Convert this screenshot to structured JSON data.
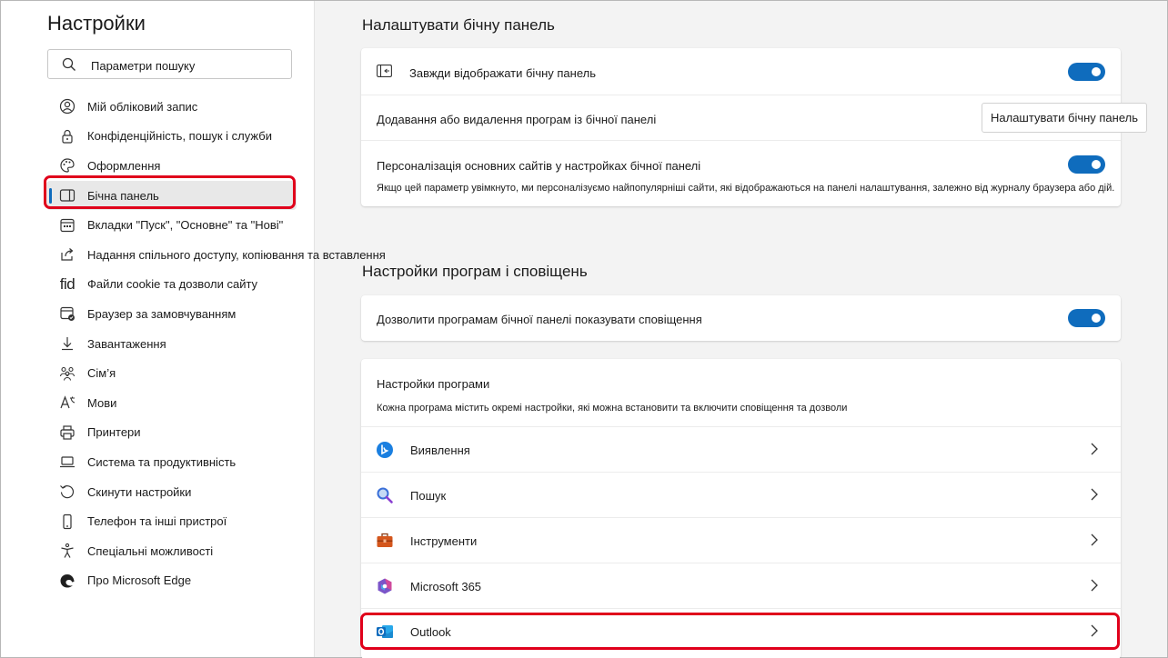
{
  "sidebar": {
    "title": "Настройки",
    "search_placeholder": "Параметри пошуку",
    "items": [
      {
        "label": "Мій обліковий запис",
        "icon": "account-icon"
      },
      {
        "label": "Конфіденційність, пошук і служби",
        "icon": "lock-icon"
      },
      {
        "label": "Оформлення",
        "icon": "palette-icon"
      },
      {
        "label": "Бічна панель",
        "icon": "sidebar-panel-icon"
      },
      {
        "label": "Вкладки \"Пуск\", \"Основне\" та \"Нові\"",
        "icon": "start-tab-icon"
      },
      {
        "label": "Надання спільного доступу, копіювання та вставлення",
        "icon": "share-icon"
      },
      {
        "label": "Файли cookie та дозволи сайту",
        "icon": "cookie-icon"
      },
      {
        "label": "Браузер за замовчуванням",
        "icon": "default-browser-icon"
      },
      {
        "label": "Завантаження",
        "icon": "download-icon"
      },
      {
        "label": "Сім’я",
        "icon": "family-icon"
      },
      {
        "label": "Мови",
        "icon": "language-icon"
      },
      {
        "label": "Принтери",
        "icon": "printer-icon"
      },
      {
        "label": "Система та продуктивність",
        "icon": "laptop-icon"
      },
      {
        "label": "Скинути настройки",
        "icon": "reset-icon"
      },
      {
        "label": "Телефон  та інші пристрої",
        "icon": "phone-icon"
      },
      {
        "label": "Спеціальні можливості",
        "icon": "accessibility-icon"
      },
      {
        "label": "Про Microsoft Edge",
        "icon": "edge-logo-icon"
      }
    ],
    "cookie_icon_text": "fid",
    "active_index": 3
  },
  "main": {
    "section1": {
      "title": "Налаштувати бічну панель",
      "always_show_label": "Завжди відображати бічну панель",
      "always_show_on": true,
      "add_remove_label": "Додавання або видалення програм із бічної панелі",
      "customize_button": "Налаштувати бічну панель",
      "personalize_label": "Персоналізація основних сайтів у настройках бічної панелі",
      "personalize_desc": "Якщо цей параметр увімкнуто, ми персоналізуємо найпопулярніші сайти, які відображаються на панелі налаштування, залежно від журналу браузера або дій.",
      "personalize_on": true
    },
    "section2": {
      "title": "Настройки програм і сповіщень",
      "allow_notifications_label": "Дозволити програмам бічної панелі показувати сповіщення",
      "allow_notifications_on": true,
      "app_settings_title": "Настройки програми",
      "app_settings_desc": "Кожна програма містить окремі настройки, які можна встановити та включити сповіщення та дозволи",
      "apps": [
        {
          "label": "Виявлення",
          "icon": "bing-discover-icon"
        },
        {
          "label": "Пошук",
          "icon": "search-magnifier-icon"
        },
        {
          "label": "Інструменти",
          "icon": "toolbox-icon"
        },
        {
          "label": "Microsoft 365",
          "icon": "microsoft-365-icon"
        },
        {
          "label": "Outlook",
          "icon": "outlook-icon"
        }
      ]
    }
  },
  "colors": {
    "accent": "#0f6cbd",
    "highlight": "#e0001b"
  }
}
